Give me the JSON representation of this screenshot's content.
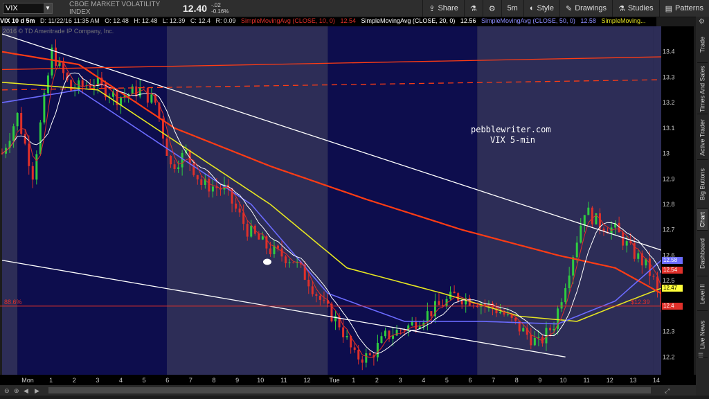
{
  "toolbar": {
    "symbol": "VIX",
    "name": "CBOE MARKET VOLATILITY INDEX",
    "last": "12.40",
    "change": "-.02",
    "change_pct": "-0.16%",
    "buttons": [
      {
        "label": "Share",
        "icon": "share-icon"
      },
      {
        "label": "",
        "icon": "flask-icon"
      },
      {
        "label": "",
        "icon": "gear-icon"
      },
      {
        "label": "5m",
        "icon": ""
      },
      {
        "label": "Style",
        "icon": "palette-icon"
      },
      {
        "label": "Drawings",
        "icon": "pencil-icon"
      },
      {
        "label": "Studies",
        "icon": "flask-icon"
      },
      {
        "label": "Patterns",
        "icon": "patterns-icon"
      }
    ]
  },
  "info": {
    "symbol": "VIX 10 d 5m",
    "date": "D: 11/22/16 11:35 AM",
    "open": "O: 12.48",
    "high": "H: 12.48",
    "low": "L: 12.39",
    "close": "C: 12.4",
    "range": "R: 0.09",
    "sma10": "SimpleMovingAvg (CLOSE, 10, 0)",
    "sma10_val": "12.54",
    "sma20": "SimpleMovingAvg (CLOSE, 20, 0)",
    "sma20_val": "12.56",
    "sma50": "SimpleMovingAvg (CLOSE, 50, 0)",
    "sma50_val": "12.58",
    "sma_more": "SimpleMoving...",
    "copyright": "2016 © TD Ameritrade IP Company, Inc."
  },
  "annotation": {
    "line1": "pebblewriter.com",
    "line2": "VIX 5-min"
  },
  "price_tags": [
    {
      "val": "12.58",
      "color": "#6b6bff",
      "text": "#fff"
    },
    {
      "val": "12.54",
      "color": "#e0302a",
      "text": "#fff"
    },
    {
      "val": "12.47",
      "color": "#ffff3a",
      "text": "#000"
    },
    {
      "val": "12.4",
      "color": "#e0302a",
      "text": "#fff"
    }
  ],
  "fib_label": "88.6%",
  "fib_price": "$12.39",
  "side_tabs": [
    "Trade",
    "Times And Sales",
    "Active Trader",
    "Big Buttons",
    "Chart",
    "Dashboard",
    "Level II",
    "Live News"
  ],
  "colors": {
    "bg_session": "#0d0d4d",
    "bg_off": "#2d2d57",
    "sma10": "#e0302a",
    "sma20": "#ffffff",
    "sma50": "#6b6bff",
    "sma100": "#ff3c14",
    "sma200": "#e5e522",
    "up": "#2ecc40",
    "down": "#e0302a"
  },
  "chart_data": {
    "type": "candlestick",
    "ylim": [
      12.13,
      13.5
    ],
    "y_ticks": [
      12.2,
      12.3,
      12.4,
      12.5,
      12.6,
      12.7,
      12.8,
      12.9,
      13,
      13.1,
      13.2,
      13.3,
      13.4
    ],
    "x_ticks": [
      "Mon",
      "1",
      "2",
      "3",
      "4",
      "5",
      "6",
      "7",
      "8",
      "9",
      "10",
      "11",
      "12",
      "Tue",
      "1",
      "2",
      "3",
      "4",
      "5",
      "6",
      "7",
      "8",
      "9",
      "10",
      "11",
      "12",
      "13",
      "14"
    ],
    "price_path": [
      [
        0,
        13.0
      ],
      [
        4,
        13.15
      ],
      [
        8,
        12.92
      ],
      [
        13,
        13.4
      ],
      [
        18,
        13.25
      ],
      [
        24,
        13.28
      ],
      [
        30,
        13.22
      ],
      [
        36,
        13.25
      ],
      [
        40,
        13.2
      ],
      [
        44,
        12.95
      ],
      [
        48,
        13.0
      ],
      [
        52,
        12.88
      ],
      [
        58,
        12.86
      ],
      [
        64,
        12.7
      ],
      [
        70,
        12.62
      ],
      [
        76,
        12.58
      ],
      [
        80,
        12.5
      ],
      [
        84,
        12.4
      ],
      [
        88,
        12.33
      ],
      [
        92,
        12.2
      ],
      [
        96,
        12.2
      ],
      [
        100,
        12.28
      ],
      [
        106,
        12.32
      ],
      [
        112,
        12.38
      ],
      [
        118,
        12.44
      ],
      [
        124,
        12.42
      ],
      [
        130,
        12.38
      ],
      [
        136,
        12.3
      ],
      [
        140,
        12.25
      ],
      [
        144,
        12.33
      ],
      [
        148,
        12.55
      ],
      [
        152,
        12.78
      ],
      [
        156,
        12.72
      ],
      [
        160,
        12.7
      ],
      [
        164,
        12.62
      ],
      [
        168,
        12.56
      ],
      [
        170,
        12.5
      ],
      [
        172,
        12.4
      ]
    ],
    "sma200": [
      [
        0,
        13.28
      ],
      [
        25,
        13.25
      ],
      [
        45,
        13.05
      ],
      [
        70,
        12.8
      ],
      [
        90,
        12.55
      ],
      [
        115,
        12.45
      ],
      [
        135,
        12.36
      ],
      [
        150,
        12.34
      ],
      [
        160,
        12.4
      ],
      [
        172,
        12.47
      ]
    ],
    "sma100": [
      [
        0,
        13.4
      ],
      [
        20,
        13.35
      ],
      [
        45,
        13.1
      ],
      [
        70,
        12.95
      ],
      [
        95,
        12.82
      ],
      [
        120,
        12.7
      ],
      [
        145,
        12.6
      ],
      [
        160,
        12.55
      ],
      [
        172,
        12.45
      ]
    ],
    "sma50": [
      [
        0,
        13.2
      ],
      [
        20,
        13.25
      ],
      [
        45,
        13.0
      ],
      [
        65,
        12.8
      ],
      [
        85,
        12.45
      ],
      [
        105,
        12.34
      ],
      [
        125,
        12.34
      ],
      [
        145,
        12.33
      ],
      [
        160,
        12.42
      ],
      [
        172,
        12.58
      ]
    ],
    "fib_level": 12.4,
    "trendlines": [
      {
        "from": [
          0,
          13.47
        ],
        "to": [
          172,
          12.62
        ],
        "color": "#ffffff"
      },
      {
        "from": [
          0,
          12.58
        ],
        "to": [
          147,
          12.2
        ],
        "color": "#ffffff"
      },
      {
        "from": [
          0,
          13.33
        ],
        "to": [
          172,
          13.38
        ],
        "color": "#ff3c14"
      },
      {
        "from": [
          0,
          13.25
        ],
        "to": [
          172,
          13.29
        ],
        "color": "#ff3c14",
        "dash": true
      }
    ],
    "sessions": [
      [
        0,
        4,
        false
      ],
      [
        4,
        43,
        true
      ],
      [
        43,
        85,
        false
      ],
      [
        85,
        124,
        true
      ],
      [
        124,
        170,
        false
      ]
    ]
  }
}
